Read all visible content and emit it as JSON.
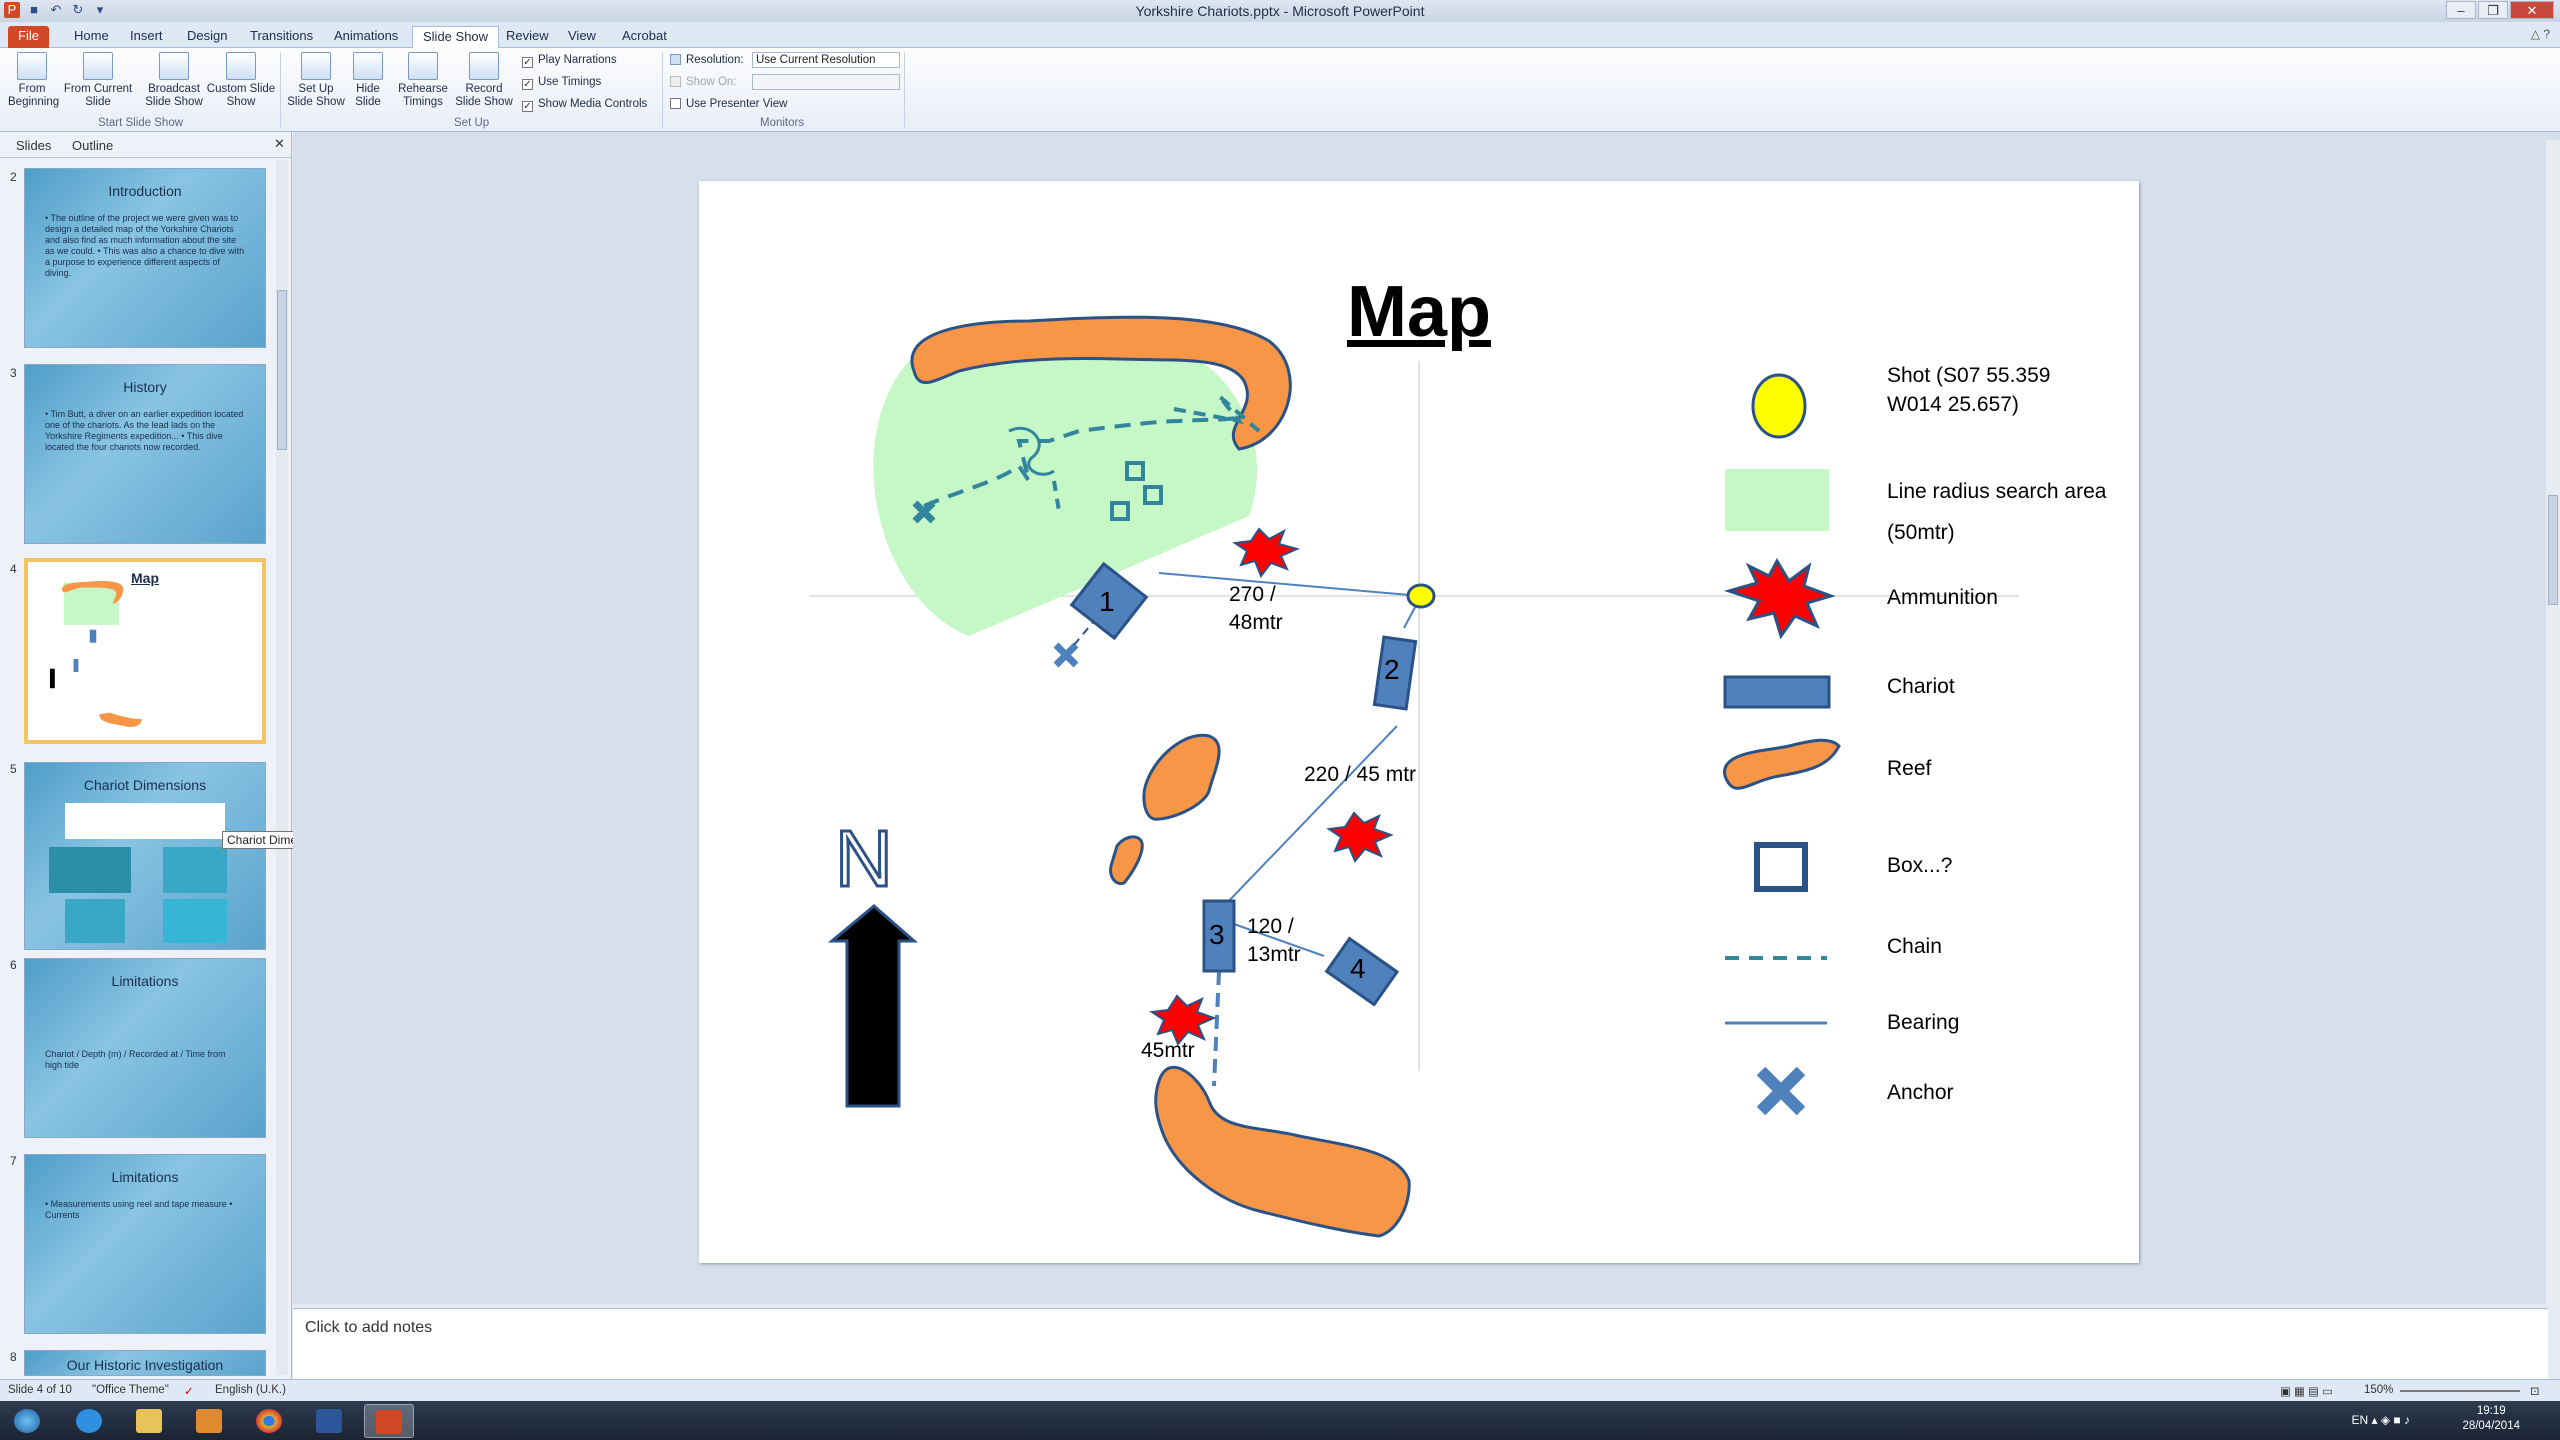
{
  "window": {
    "title": "Yorkshire Chariots.pptx - Microsoft PowerPoint"
  },
  "tabs": [
    "File",
    "Home",
    "Insert",
    "Design",
    "Transitions",
    "Animations",
    "Slide Show",
    "Review",
    "View",
    "Acrobat"
  ],
  "ribbon": {
    "from_beginning": "From Beginning",
    "from_current": "From Current Slide",
    "broadcast": "Broadcast Slide Show",
    "custom": "Custom Slide Show",
    "group_start": "Start Slide Show",
    "setup": "Set Up Slide Show",
    "hide": "Hide Slide",
    "rehearse": "Rehearse Timings",
    "record": "Record Slide Show",
    "group_setup": "Set Up",
    "play_narrations": "Play Narrations",
    "use_timings": "Use Timings",
    "show_media": "Show Media Controls",
    "resolution_label": "Resolution:",
    "resolution_value": "Use Current Resolution",
    "show_on": "Show On:",
    "presenter_view": "Use Presenter View",
    "group_monitors": "Monitors"
  },
  "left_pane": {
    "tab_slides": "Slides",
    "tab_outline": "Outline",
    "thumbs": [
      {
        "num": "2",
        "title": "Introduction",
        "text": "• The outline of the project we were given was to design a detailed map of the Yorkshire Chariots and also find as much information about the site as we could. • This was also a chance to dive with a purpose to experience different aspects of diving."
      },
      {
        "num": "3",
        "title": "History",
        "text": "• Tim Butt, a diver on an earlier expedition located one of the chariots. As the lead lads on the Yorkshire Regiments expedition... • This dive located the four chariots now recorded."
      },
      {
        "num": "4",
        "title": "Map",
        "text": ""
      },
      {
        "num": "5",
        "title": "Chariot Dimensions",
        "text": ""
      },
      {
        "num": "6",
        "title": "Limitations",
        "text": "Chariot / Depth (m) / Recorded at / Time from high tide"
      },
      {
        "num": "7",
        "title": "Limitations",
        "text": "• Measurements using reel and tape measure • Currents"
      },
      {
        "num": "8",
        "title": "Our Historic Investigation",
        "text": ""
      }
    ],
    "tooltip": "Chariot Dimensions"
  },
  "slide": {
    "title": "Map",
    "bearing1": "270 /",
    "bearing1b": "48mtr",
    "bearing2": "220 / 45 mtr",
    "bearing3": "120 /",
    "bearing3b": "13mtr",
    "dist4": "45mtr",
    "chariots": [
      "1",
      "2",
      "3",
      "4"
    ],
    "north": "N",
    "legend": [
      {
        "icon": "shot-icon",
        "label": "Shot (S07 55.359  W014 25.657)"
      },
      {
        "icon": "search-area-icon",
        "label": "Line radius search area (50mtr)"
      },
      {
        "icon": "ammunition-icon",
        "label": "Ammunition"
      },
      {
        "icon": "chariot-icon",
        "label": "Chariot"
      },
      {
        "icon": "reef-icon",
        "label": "Reef"
      },
      {
        "icon": "box-icon",
        "label": "Box...?"
      },
      {
        "icon": "chain-icon",
        "label": "Chain"
      },
      {
        "icon": "bearing-icon",
        "label": "Bearing"
      },
      {
        "icon": "anchor-icon",
        "label": "Anchor"
      }
    ],
    "colors": {
      "reef": "#f79646",
      "chariot": "#4f81bd",
      "search": "#c6f7c6",
      "shot": "#ffff00",
      "ammo": "#ff0000",
      "outline": "#2b5286"
    }
  },
  "notes": {
    "placeholder": "Click to add notes"
  },
  "status": {
    "slide": "Slide 4 of 10",
    "theme": "\"Office Theme\"",
    "lang": "English (U.K.)",
    "zoom": "150%"
  },
  "taskbar": {
    "time": "19:19",
    "date": "28/04/2014",
    "lang": "EN"
  }
}
